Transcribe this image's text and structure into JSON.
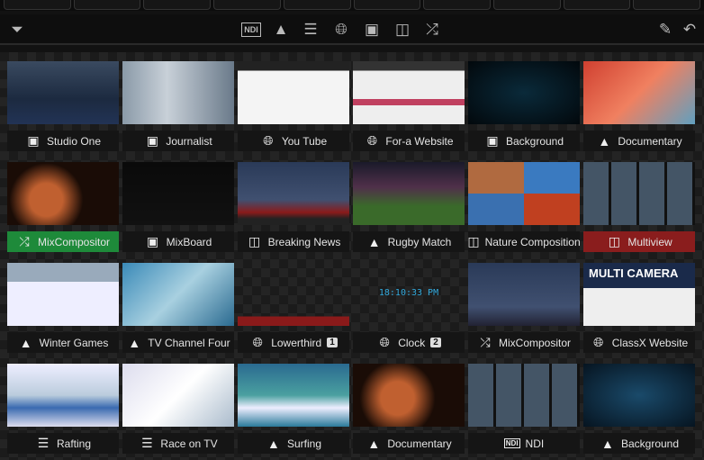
{
  "toolbar": {
    "left": "filter-icon",
    "center": [
      "ndi-icon",
      "vlc-cone-icon",
      "playlist-icon",
      "web-browser-icon",
      "video-monitor-icon",
      "multiview-icon",
      "mixcompositor-icon"
    ],
    "right": [
      "pencil-icon",
      "undo-icon"
    ]
  },
  "colors": {
    "active_green": "#1e8a3a",
    "active_red": "#8a1d1d"
  },
  "tiles": [
    {
      "label": "Studio One",
      "icon": "monitor",
      "thumb": "linear-gradient(#3a4a60,#1c2a40 60%,#223355)"
    },
    {
      "label": "Journalist",
      "icon": "monitor",
      "thumb": "linear-gradient(90deg,#8a9aa8,#c8d0d8 40%,#6a7a8a)"
    },
    {
      "label": "You Tube",
      "icon": "web",
      "thumb": "linear-gradient(#222 0 15%,#f4f4f4 15%)"
    },
    {
      "label": "For-a Website",
      "icon": "web",
      "thumb": "linear-gradient(#333 0 15%,#eee 15% 60%,#c04060 60% 70%,#eee 70%)"
    },
    {
      "label": "Background",
      "icon": "monitor",
      "thumb": "radial-gradient(#0a2a3a,#02080c)"
    },
    {
      "label": "Documentary",
      "icon": "vlc",
      "thumb": "linear-gradient(135deg,#d04030,#f08060 50%,#60a0c0)"
    },
    {
      "label": "MixCompositor",
      "icon": "compositor",
      "thumb": "radial-gradient(circle at 35% 60%,#c06030 0 20%,#1a0c06 45%)",
      "state": "green"
    },
    {
      "label": "MixBoard",
      "icon": "monitor",
      "thumb": "linear-gradient(#0a0a0a,#111)"
    },
    {
      "label": "Breaking News",
      "icon": "multiview",
      "thumb": "linear-gradient(#2a3a58,#405070 60%,#8a1a1a 80%,#222 90%)"
    },
    {
      "label": "Rugby Match",
      "icon": "vlc",
      "thumb": "linear-gradient(#1a1a2a,#50304a 40%,#3a6a2a 70%)"
    },
    {
      "label": "Nature Composition",
      "icon": "multiview",
      "thumb": "conic-gradient(#3a7ac0 0 25%,#c04020 0 50%,#3a70b0 0 75%,#b06a40 0)"
    },
    {
      "label": "Multiview",
      "icon": "multiview",
      "thumb": "repeating-linear-gradient(90deg,#456 0 28px,#111 28px 31px)",
      "state": "red"
    },
    {
      "label": "Winter Games",
      "icon": "vlc",
      "thumb": "linear-gradient(#9ab 0 30%,#eef 30%)"
    },
    {
      "label": "TV Channel Four",
      "icon": "vlc",
      "thumb": "linear-gradient(135deg,#3a8ab8,#a8d0e0 50%,#2a6a90)"
    },
    {
      "label": "Lowerthird",
      "icon": "web",
      "badge": "1",
      "thumb": "linear-gradient(transparent 85%,#8a1a1a 85%)"
    },
    {
      "label": "Clock",
      "icon": "web",
      "badge": "2",
      "thumb": "transparent",
      "overlay": "18:10:33 PM"
    },
    {
      "label": "MixCompositor",
      "icon": "compositor",
      "thumb": "linear-gradient(#2a3a58,#405070 70%,#223)"
    },
    {
      "label": "ClassX Website",
      "icon": "web",
      "thumb": "linear-gradient(#1a2a4a 0 40%,#eee 40%)",
      "overlay": "MULTI CAMERA"
    },
    {
      "label": "Rafting",
      "icon": "playlist",
      "thumb": "linear-gradient(#eef,#bcd 50%,#3a6ab0 70%,#dde)"
    },
    {
      "label": "Race on TV",
      "icon": "playlist",
      "thumb": "linear-gradient(135deg,#dde,#fff 50%,#abc)"
    },
    {
      "label": "Surfing",
      "icon": "vlc",
      "thumb": "linear-gradient(#2a6a90,#4aa0a0 50%,#eef 70%,#2a7a9a)"
    },
    {
      "label": "Documentary",
      "icon": "vlc",
      "thumb": "radial-gradient(circle at 40% 55%,#c06030 0 22%,#1a0c06 50%)"
    },
    {
      "label": "NDI",
      "icon": "ndi",
      "thumb": "repeating-linear-gradient(90deg,#456 0 28px,#111 28px 31px)"
    },
    {
      "label": "Background",
      "icon": "vlc",
      "thumb": "radial-gradient(#1a4a6a,#061420)"
    }
  ]
}
